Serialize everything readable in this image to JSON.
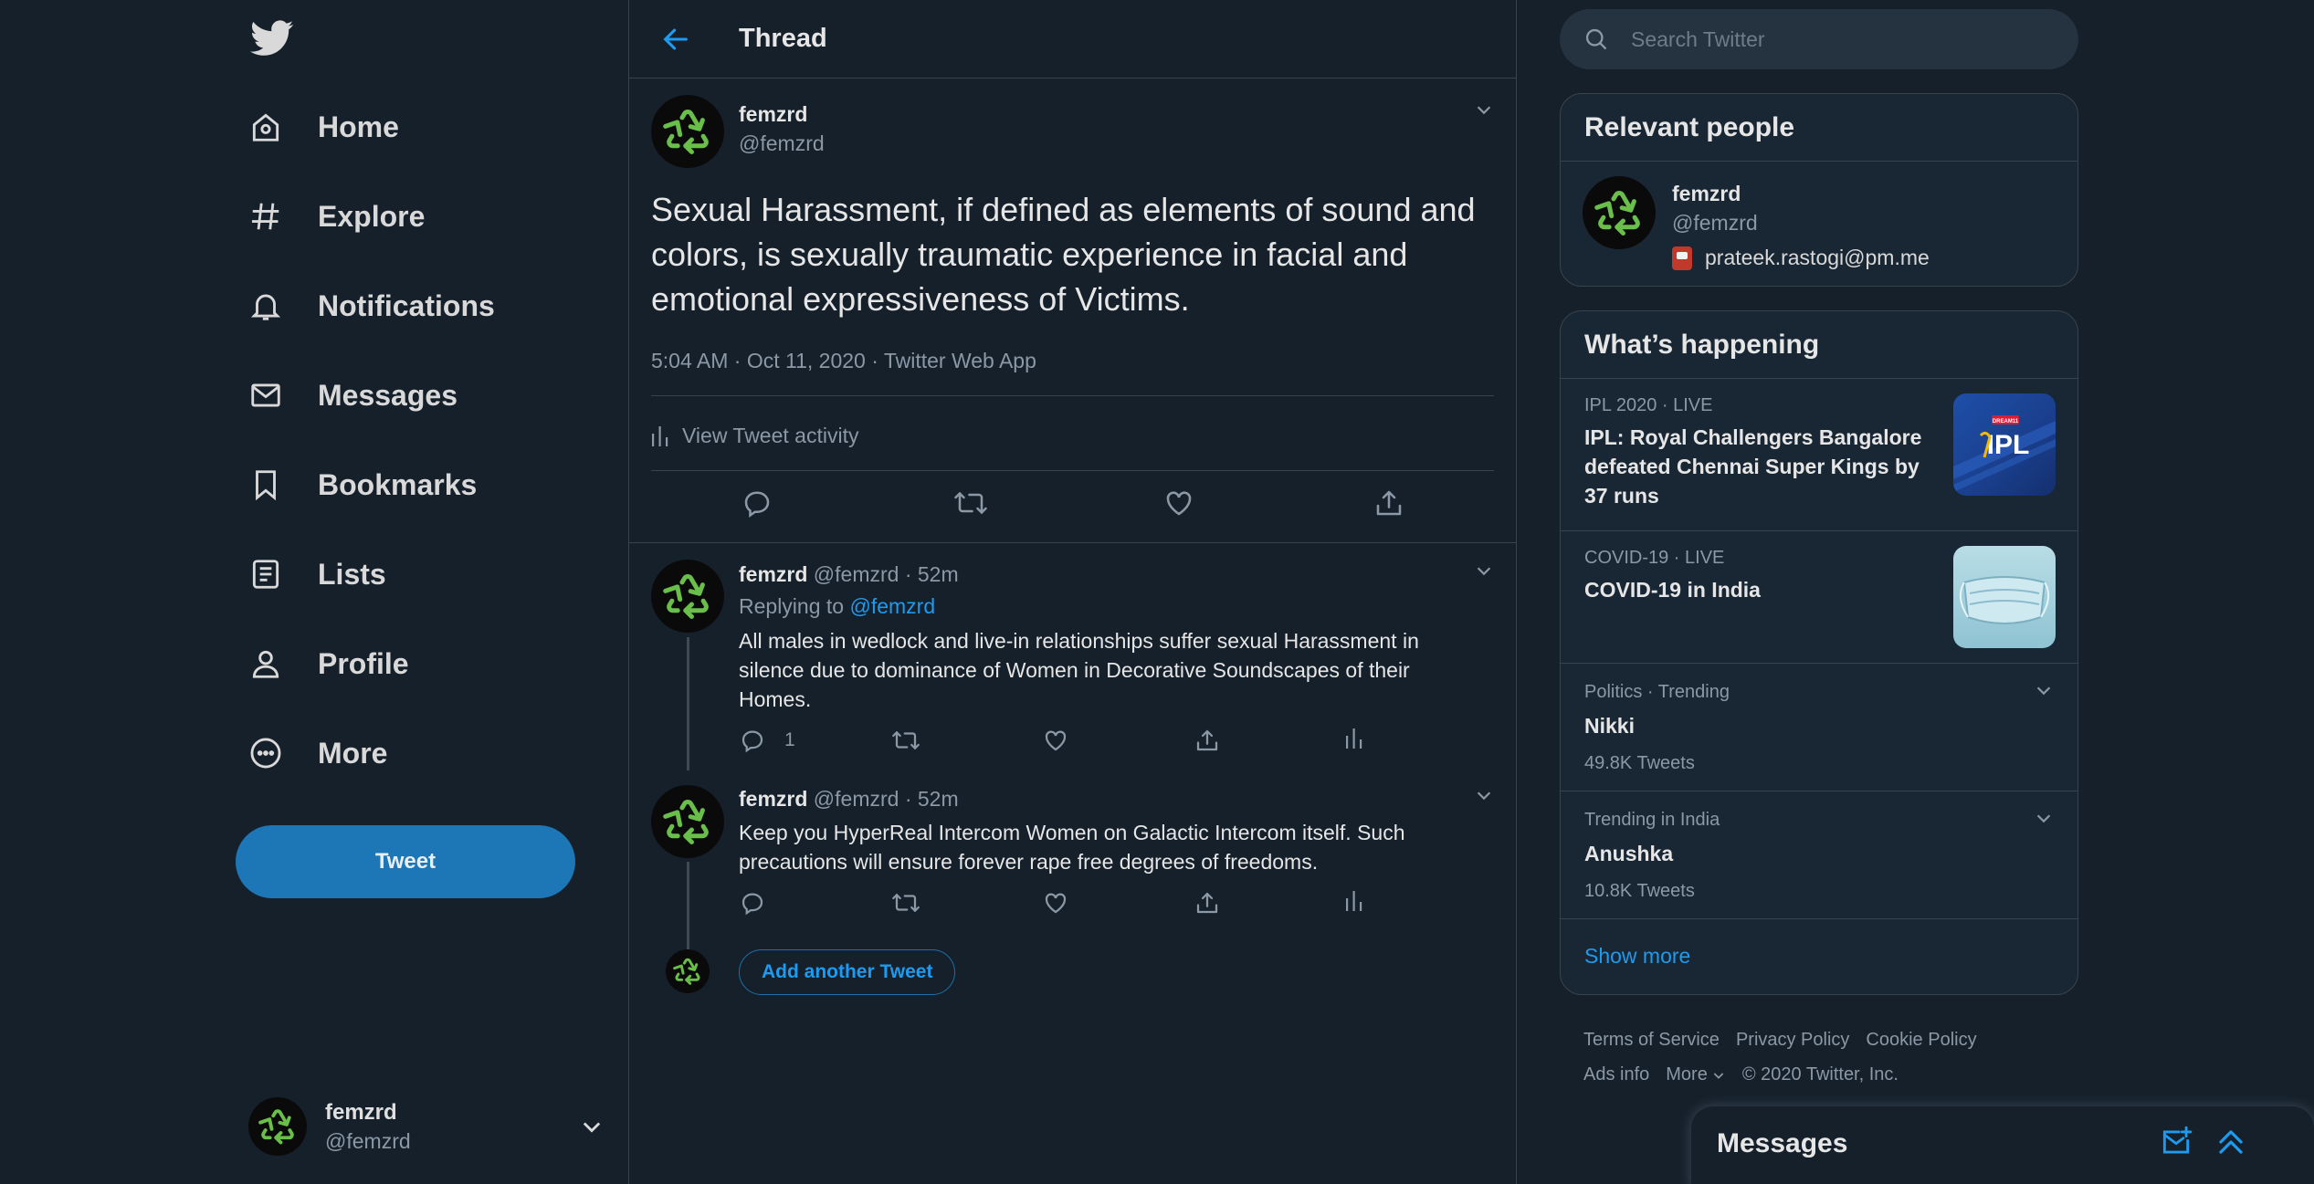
{
  "colors": {
    "background": "#15202b",
    "accent": "#1d9bf0",
    "tweet_button": "#1d76b5",
    "muted_text": "#8b98a5",
    "border": "#38444d",
    "avatar_recycle": "#6abf4b"
  },
  "nav": {
    "logo_icon": "bird-icon",
    "items": [
      {
        "label": "Home",
        "icon": "home-icon"
      },
      {
        "label": "Explore",
        "icon": "hashtag-icon"
      },
      {
        "label": "Notifications",
        "icon": "bell-icon"
      },
      {
        "label": "Messages",
        "icon": "envelope-icon"
      },
      {
        "label": "Bookmarks",
        "icon": "bookmark-icon"
      },
      {
        "label": "Lists",
        "icon": "list-icon"
      },
      {
        "label": "Profile",
        "icon": "person-icon"
      },
      {
        "label": "More",
        "icon": "more-circle-icon"
      }
    ],
    "tweet_button": "Tweet",
    "account": {
      "name": "femzrd",
      "handle": "@femzrd"
    }
  },
  "thread": {
    "title": "Thread",
    "main_tweet": {
      "name": "femzrd",
      "handle": "@femzrd",
      "text": "Sexual Harassment, if defined as elements of sound and colors, is sexually traumatic experience in facial and emotional expressiveness of Victims.",
      "meta": "5:04 AM · Oct 11, 2020 · Twitter Web App",
      "activity_label": "View Tweet activity"
    },
    "replies": [
      {
        "name": "femzrd",
        "handle_time": "@femzrd · 52m",
        "replying_prefix": "Replying to ",
        "replying_to": "@femzrd",
        "text": "All males in wedlock and live-in relationships suffer sexual Harassment in silence due to dominance of Women in Decorative Soundscapes of their Homes.",
        "reply_count": "1"
      },
      {
        "name": "femzrd",
        "handle_time": "@femzrd · 52m",
        "text": "Keep you HyperReal Intercom Women on Galactic Intercom itself. Such precautions will ensure forever rape free degrees of freedoms."
      }
    ],
    "add_another": "Add another Tweet"
  },
  "search": {
    "placeholder": "Search Twitter"
  },
  "relevant_people": {
    "title": "Relevant people",
    "name": "femzrd",
    "handle": "@femzrd",
    "bio": "prateek.rastogi@pm.me"
  },
  "whats_happening": {
    "title": "What’s happening",
    "trends": [
      {
        "meta": "IPL 2020 · LIVE",
        "title": "IPL: Royal Challengers Bangalore defeated Chennai Super Kings by 37 runs",
        "image": "ipl-logo"
      },
      {
        "meta": "COVID-19 · LIVE",
        "title": "COVID-19 in India",
        "image": "face-mask-photo"
      },
      {
        "meta": "Politics · Trending",
        "title": "Nikki",
        "count": "49.8K Tweets"
      },
      {
        "meta": "Trending in India",
        "title": "Anushka",
        "count": "10.8K Tweets"
      }
    ],
    "show_more": "Show more",
    "ipl_logo_text": "IPL",
    "ipl_badge_text": "DREAM11"
  },
  "footer": {
    "links": [
      "Terms of Service",
      "Privacy Policy",
      "Cookie Policy",
      "Ads info",
      "More"
    ],
    "copyright": "© 2020 Twitter, Inc."
  },
  "messages_drawer": {
    "title": "Messages"
  }
}
